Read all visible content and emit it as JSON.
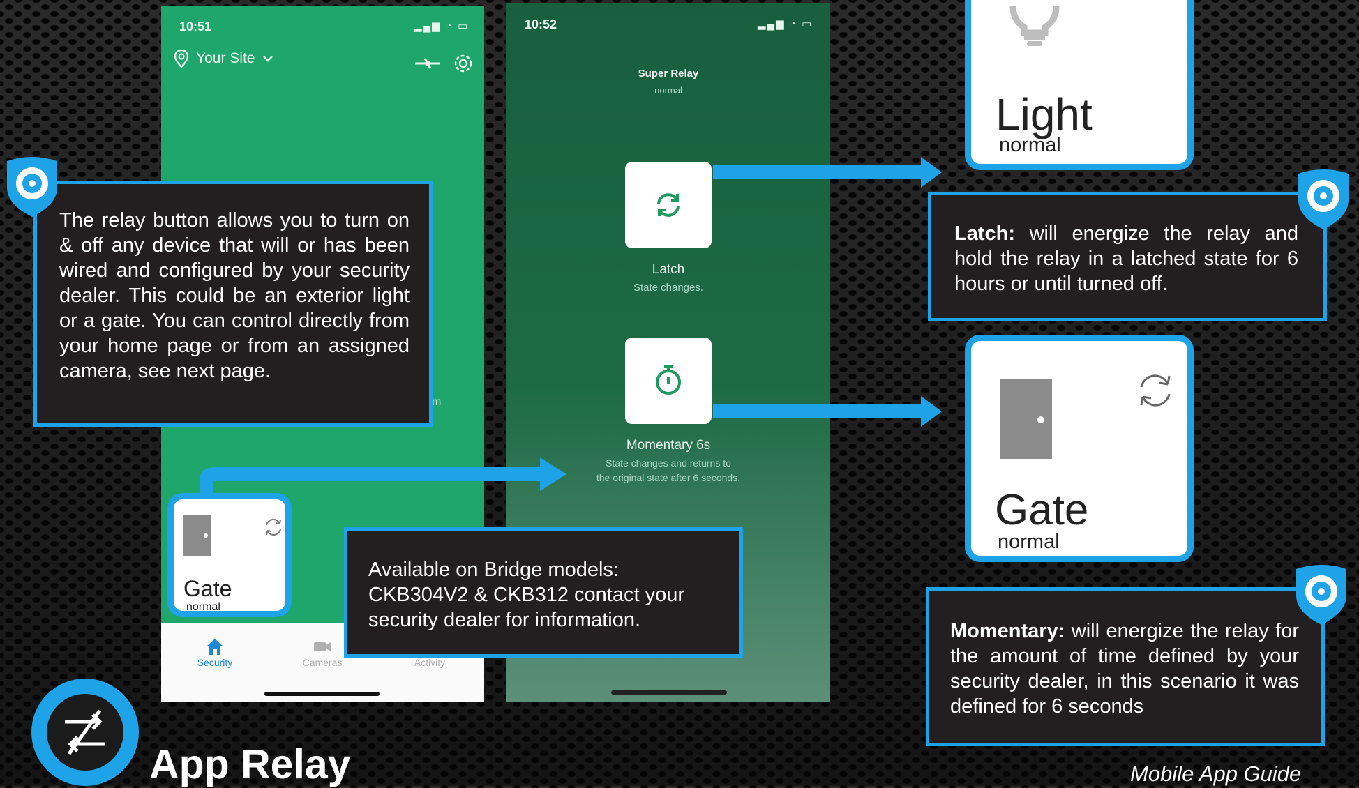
{
  "phone_home": {
    "time": "10:51",
    "site_name": "Your Site",
    "tabs": [
      {
        "label": "Security",
        "icon": "home-icon"
      },
      {
        "label": "Cameras",
        "icon": "camera-icon"
      },
      {
        "label": "Activity",
        "icon": "activity-icon"
      }
    ],
    "partial_text": "m"
  },
  "gate_card_small": {
    "title": "Gate",
    "status": "normal"
  },
  "phone_relay": {
    "time": "10:52",
    "title": "Super Relay",
    "subtitle": "normal",
    "latch": {
      "label": "Latch",
      "desc": "State changes."
    },
    "momentary": {
      "label": "Momentary 6s",
      "desc_line1": "State changes and returns to",
      "desc_line2": "the original state after 6 seconds."
    }
  },
  "callouts": {
    "relay_intro": "The relay button allows you  to turn on & off any device that will or has been wired and configured by your security dealer. This could be an exterior light or a gate. You can control directly from your home page or from an assigned camera, see next page.",
    "bridge_models": "Available on Bridge models: CKB304V2 & CKB312 contact your security dealer for information.",
    "latch_bold": "Latch:",
    "latch_text": " will energize the relay and hold the relay in a latched state for 6 hours or until turned off.",
    "momentary_bold": "Momentary:",
    "momentary_text": " will energize the relay for the amount of time defined by your security dealer, in this scenario it was defined for 6 seconds"
  },
  "light_card": {
    "title": "Light",
    "status": "normal"
  },
  "gate_card_large": {
    "title": "Gate",
    "status": "normal"
  },
  "footer": {
    "title": "App Relay",
    "guide": "Mobile App Guide"
  },
  "colors": {
    "accent": "#1ea3e8",
    "app_green": "#1fa66a",
    "dark_green": "#185f3d",
    "callout_bg": "#231f20"
  }
}
